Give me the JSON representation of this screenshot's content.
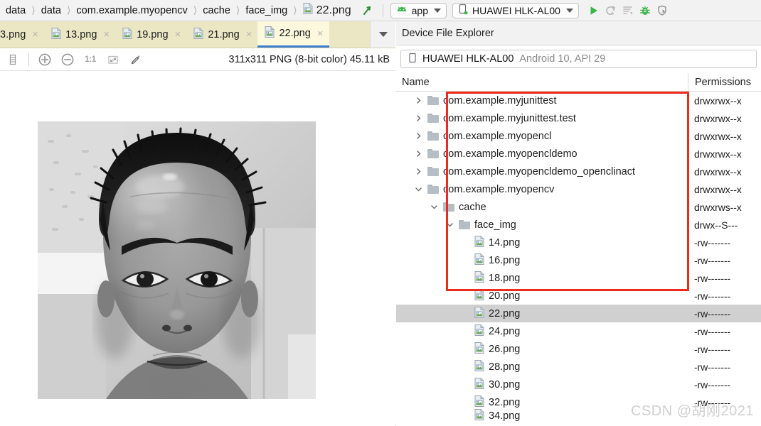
{
  "toolbar": {
    "breadcrumb": [
      "data",
      "data",
      "com.example.myopencv",
      "cache",
      "face_img"
    ],
    "breadcrumb_file": "22.png",
    "breadcrumb_file_icon": "image-file-icon",
    "arrow_icon": "navigate-up-icon",
    "run_config": "app",
    "run_config_icon": "android-icon",
    "device": "HUAWEI HLK-AL00",
    "device_icon": "phone-icon",
    "actions": [
      {
        "name": "run-button",
        "icon": "play-icon"
      },
      {
        "name": "apply-changes-button",
        "icon": "apply-changes-icon"
      },
      {
        "name": "apply-code-changes-button",
        "icon": "apply-code-changes-icon"
      },
      {
        "name": "debug-button",
        "icon": "bug-icon"
      },
      {
        "name": "attach-debugger-button",
        "icon": "attach-debugger-icon"
      }
    ]
  },
  "editor": {
    "tabs": [
      {
        "label": "3.png",
        "active": false,
        "truncated": true
      },
      {
        "label": "13.png",
        "active": false
      },
      {
        "label": "19.png",
        "active": false
      },
      {
        "label": "21.png",
        "active": false
      },
      {
        "label": "22.png",
        "active": true
      }
    ],
    "tab_close_glyph": "×",
    "tab_overflow_icon": "chevron-down-icon",
    "image_toolbar": [
      {
        "name": "toggle-grid-button",
        "icon": "grid-icon",
        "label": ""
      },
      {
        "name": "zoom-in-button",
        "icon": "zoom-in-icon",
        "label": ""
      },
      {
        "name": "zoom-out-button",
        "icon": "zoom-out-icon",
        "label": ""
      },
      {
        "name": "actual-size-button",
        "icon": "one-to-one-icon",
        "label": "1:1"
      },
      {
        "name": "fit-to-window-button",
        "icon": "fit-window-icon",
        "label": ""
      },
      {
        "name": "color-picker-button",
        "icon": "eyedropper-icon",
        "label": ""
      }
    ],
    "image_info": "311x311 PNG (8-bit color) 45.11 kB"
  },
  "device_explorer": {
    "panel_title": "Device File Explorer",
    "device_name": "HUAWEI HLK-AL00",
    "device_meta": "Android 10, API 29",
    "device_icon": "phone-icon",
    "columns": {
      "name": "Name",
      "permissions": "Permissions"
    },
    "rows": [
      {
        "label": "com.example.myjunittest",
        "perm": "drwxrwx--x",
        "indent": 0,
        "type": "folder",
        "twisty": "collapsed"
      },
      {
        "label": "com.example.myjunittest.test",
        "perm": "drwxrwx--x",
        "indent": 0,
        "type": "folder",
        "twisty": "collapsed"
      },
      {
        "label": "com.example.myopencl",
        "perm": "drwxrwx--x",
        "indent": 0,
        "type": "folder",
        "twisty": "collapsed"
      },
      {
        "label": "com.example.myopencldemo",
        "perm": "drwxrwx--x",
        "indent": 0,
        "type": "folder",
        "twisty": "collapsed"
      },
      {
        "label": "com.example.myopencldemo_openclinact",
        "perm": "drwxrwx--x",
        "indent": 0,
        "type": "folder",
        "twisty": "collapsed"
      },
      {
        "label": "com.example.myopencv",
        "perm": "drwxrwx--x",
        "indent": 0,
        "type": "folder",
        "twisty": "expanded"
      },
      {
        "label": "cache",
        "perm": "drwxrws--x",
        "indent": 1,
        "type": "folder",
        "twisty": "expanded"
      },
      {
        "label": "face_img",
        "perm": "drwx--S---",
        "indent": 2,
        "type": "folder",
        "twisty": "expanded"
      },
      {
        "label": "14.png",
        "perm": "-rw-------",
        "indent": 3,
        "type": "file",
        "twisty": "none"
      },
      {
        "label": "16.png",
        "perm": "-rw-------",
        "indent": 3,
        "type": "file",
        "twisty": "none"
      },
      {
        "label": "18.png",
        "perm": "-rw-------",
        "indent": 3,
        "type": "file",
        "twisty": "none"
      },
      {
        "label": "20.png",
        "perm": "-rw-------",
        "indent": 3,
        "type": "file",
        "twisty": "none"
      },
      {
        "label": "22.png",
        "perm": "-rw-------",
        "indent": 3,
        "type": "file",
        "twisty": "none",
        "selected": true
      },
      {
        "label": "24.png",
        "perm": "-rw-------",
        "indent": 3,
        "type": "file",
        "twisty": "none"
      },
      {
        "label": "26.png",
        "perm": "-rw-------",
        "indent": 3,
        "type": "file",
        "twisty": "none"
      },
      {
        "label": "28.png",
        "perm": "-rw-------",
        "indent": 3,
        "type": "file",
        "twisty": "none"
      },
      {
        "label": "30.png",
        "perm": "-rw-------",
        "indent": 3,
        "type": "file",
        "twisty": "none"
      },
      {
        "label": "32.png",
        "perm": "-rw-------",
        "indent": 3,
        "type": "file",
        "twisty": "none"
      },
      {
        "label": "34.png",
        "perm": "",
        "indent": 3,
        "type": "file",
        "twisty": "none",
        "partial": true
      }
    ],
    "annotation": {
      "name": "red-highlight-box",
      "color": "#ee2b18"
    }
  },
  "watermark": "CSDN @胡刚2021",
  "colors": {
    "tab_strip": "#ebe7c4",
    "active_tab": "#fbf8dd",
    "active_tab_underline": "#3f7fd0",
    "selection": "#d0d0d0",
    "accent_green": "#3ab54a",
    "annotation_red": "#ee2b18"
  }
}
